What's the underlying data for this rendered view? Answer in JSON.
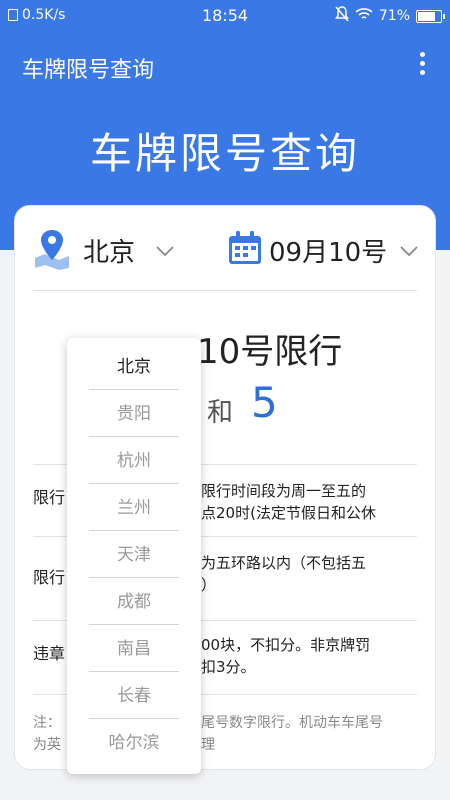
{
  "status_bar": {
    "speed": "0.5K/s",
    "time": "18:54",
    "battery": "71%"
  },
  "app_bar": {
    "title": "车牌限号查询"
  },
  "hero": {
    "title": "车牌限号查询"
  },
  "selector": {
    "city": "北京",
    "date": "09月10号"
  },
  "restriction": {
    "title_visible": "10号限行",
    "and_word": "和",
    "number": "5"
  },
  "info": {
    "rows": [
      {
        "label": "限行",
        "text": "限行时间段为周一至五的\n点20时(法定节假日和公休"
      },
      {
        "label": "限行",
        "text": "为五环路以内（不包括五\n）"
      },
      {
        "label": "违章",
        "text": "00块，不扣分。非京牌罚\n扣3分。"
      }
    ],
    "note_label": "注：\n为英",
    "note_text": "尾号数字限行。机动车车尾号\n理"
  },
  "dropdown": {
    "selected_index": 0,
    "items": [
      "北京",
      "贵阳",
      "杭州",
      "兰州",
      "天津",
      "成都",
      "南昌",
      "长春",
      "哈尔滨"
    ]
  },
  "colors": {
    "primary": "#3a78e6",
    "accent_number": "#2f6fd8"
  }
}
